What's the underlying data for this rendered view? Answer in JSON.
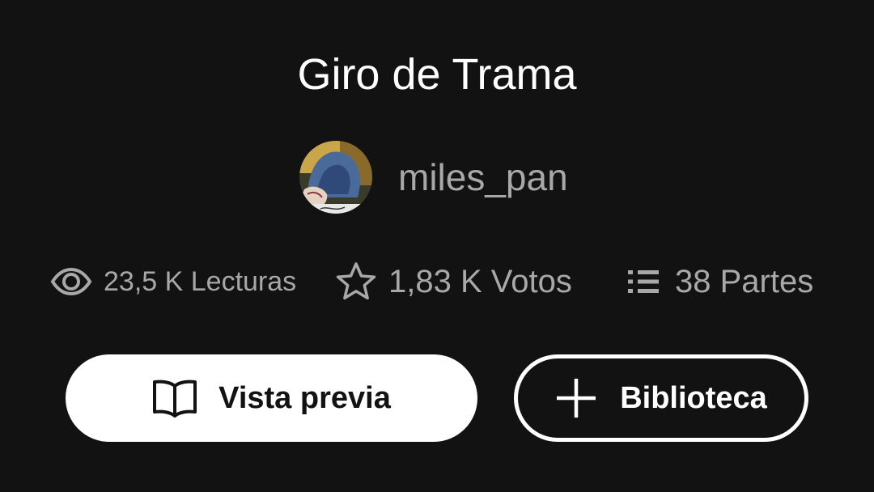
{
  "story": {
    "title": "Giro de Trama",
    "author": "miles_pan"
  },
  "stats": {
    "reads": {
      "icon": "eye-icon",
      "label": "23,5 K Lecturas"
    },
    "votes": {
      "icon": "star-icon",
      "label": "1,83 K Votos"
    },
    "parts": {
      "icon": "list-icon",
      "label": "38 Partes"
    }
  },
  "actions": {
    "preview": {
      "icon": "book-open-icon",
      "label": "Vista previa"
    },
    "library": {
      "icon": "plus-icon",
      "label": "Biblioteca"
    }
  },
  "colors": {
    "background": "#121212",
    "primary_text": "#ffffff",
    "secondary_text": "#a8a8a8"
  }
}
